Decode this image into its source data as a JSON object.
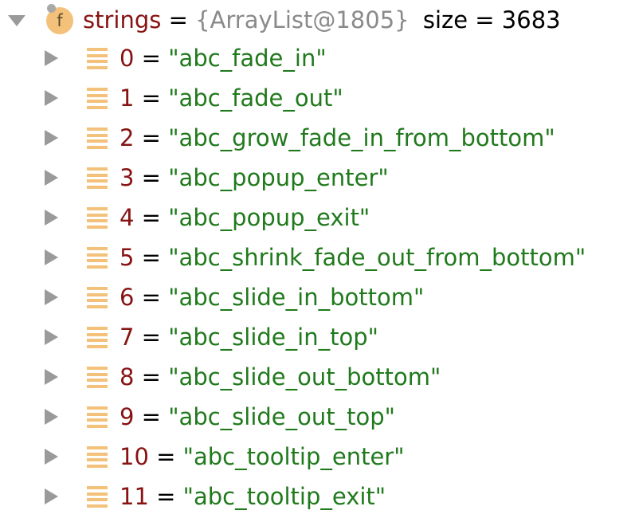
{
  "root": {
    "name": "strings",
    "equals": "=",
    "type": "{ArrayList@1805}",
    "size_text": "size = 3683",
    "icon_letter": "f"
  },
  "items": [
    {
      "index": "0",
      "equals": "=",
      "value": "\"abc_fade_in\""
    },
    {
      "index": "1",
      "equals": "=",
      "value": "\"abc_fade_out\""
    },
    {
      "index": "2",
      "equals": "=",
      "value": "\"abc_grow_fade_in_from_bottom\""
    },
    {
      "index": "3",
      "equals": "=",
      "value": "\"abc_popup_enter\""
    },
    {
      "index": "4",
      "equals": "=",
      "value": "\"abc_popup_exit\""
    },
    {
      "index": "5",
      "equals": "=",
      "value": "\"abc_shrink_fade_out_from_bottom\""
    },
    {
      "index": "6",
      "equals": "=",
      "value": "\"abc_slide_in_bottom\""
    },
    {
      "index": "7",
      "equals": "=",
      "value": "\"abc_slide_in_top\""
    },
    {
      "index": "8",
      "equals": "=",
      "value": "\"abc_slide_out_bottom\""
    },
    {
      "index": "9",
      "equals": "=",
      "value": "\"abc_slide_out_top\""
    },
    {
      "index": "10",
      "equals": "=",
      "value": "\"abc_tooltip_enter\""
    },
    {
      "index": "11",
      "equals": "=",
      "value": "\"abc_tooltip_exit\""
    }
  ],
  "colors": {
    "field_name": "#871313",
    "index": "#871313",
    "string_value": "#207a1c",
    "type_text": "#8a8a8a",
    "icon_fill": "#f4c17a",
    "expander": "#9a9a9a"
  },
  "icons": {
    "root_expander": "triangle-down-icon",
    "item_expander": "triangle-right-icon",
    "field": "field-f-icon",
    "list_item": "list-lines-icon"
  }
}
